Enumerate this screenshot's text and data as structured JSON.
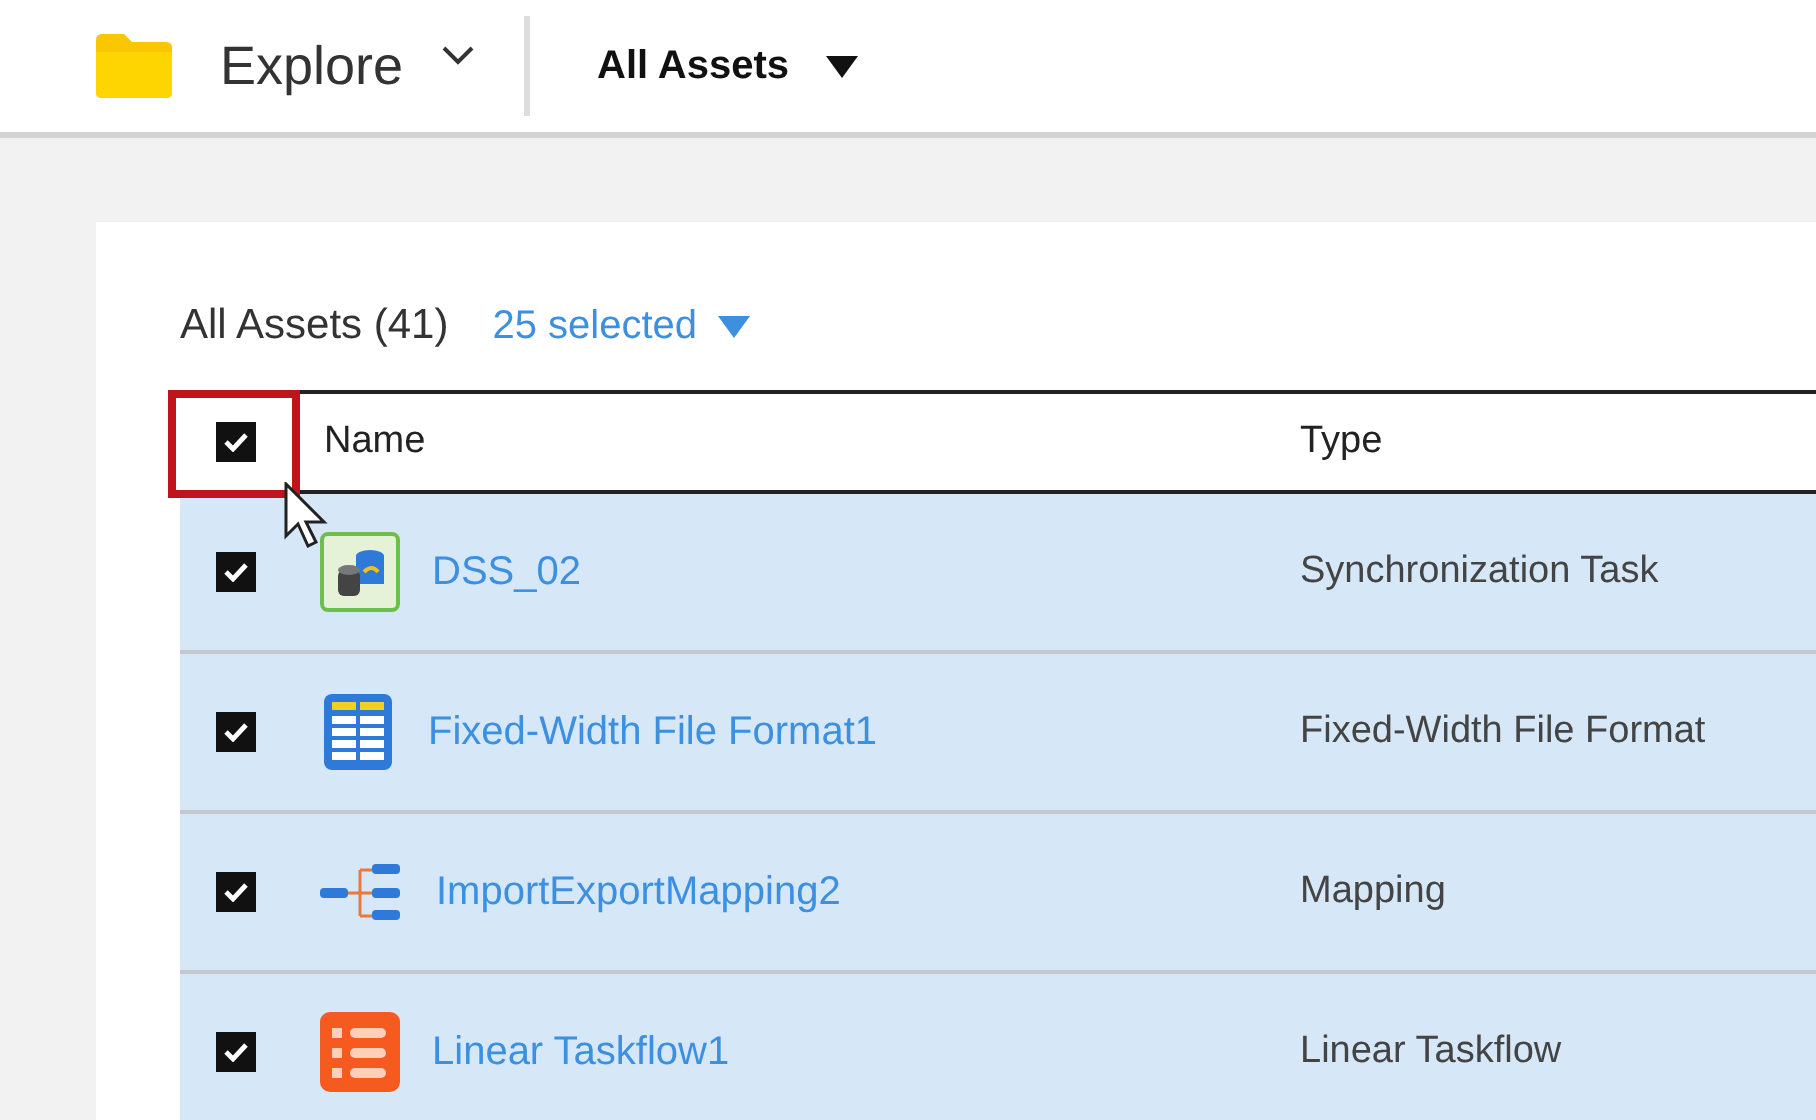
{
  "topbar": {
    "title": "Explore",
    "filter": "All Assets"
  },
  "list": {
    "heading": "All Assets (41)",
    "selection": "25 selected",
    "all_checked": true,
    "all_highlighted": true
  },
  "table": {
    "columns": [
      "Name",
      "Type"
    ],
    "rows": [
      {
        "kind": "sync",
        "name": "DSS_02",
        "type": "Synchronization Task",
        "checked": true
      },
      {
        "kind": "fileformat",
        "name": "Fixed-Width File Format1",
        "type": "Fixed-Width File Format",
        "checked": true
      },
      {
        "kind": "mapping",
        "name": "ImportExportMapping2",
        "type": "Mapping",
        "checked": true
      },
      {
        "kind": "taskflow",
        "name": "Linear Taskflow1",
        "type": "Linear Taskflow",
        "checked": true
      }
    ]
  }
}
